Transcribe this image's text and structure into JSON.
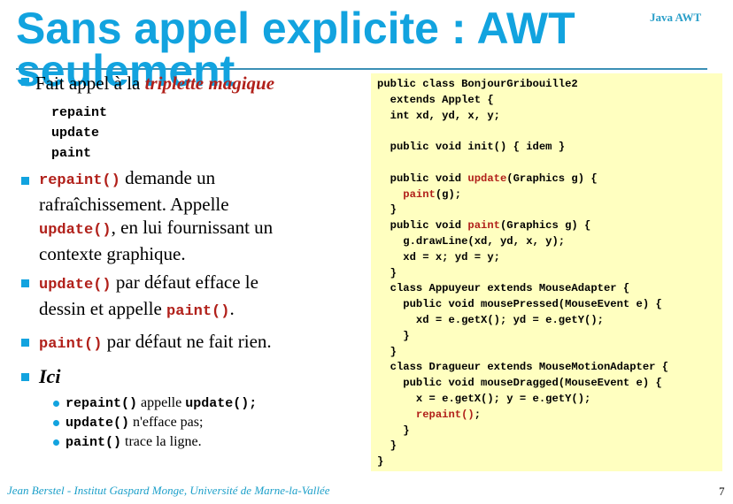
{
  "slide": {
    "title": "Sans appel explicite : AWT seulement",
    "header_tag": "Java AWT",
    "page_number": "7",
    "footer": "Jean Berstel  -   Institut Gaspard Monge, Université de Marne-la-Vallée"
  },
  "bullets": {
    "b1": {
      "prefix": "Fait appel à la ",
      "emphasis": "triplette magique",
      "methods": [
        "repaint",
        "update",
        "paint"
      ]
    },
    "b2": {
      "code1": "repaint()",
      "text1": " demande un",
      "text2": "rafraîchissement. Appelle",
      "code2": "update()",
      "text3": ", en lui fournissant un",
      "text4": "contexte graphique."
    },
    "b3": {
      "code1": "update()",
      "text1": " par défaut efface le",
      "text2": "dessin et appelle ",
      "code2": "paint()",
      "text3": "."
    },
    "b4": {
      "code1": "paint()",
      "text1": " par défaut ne fait rien."
    },
    "b5": {
      "label": "Ici",
      "items": [
        {
          "code1": "repaint()",
          "text": " appelle ",
          "code2": "update();"
        },
        {
          "code1": "update()",
          "text": " n'efface pas;"
        },
        {
          "code1": "paint()",
          "text": " trace la ligne."
        }
      ]
    }
  },
  "code": {
    "lines": [
      {
        "t": "public class BonjourGribouille2"
      },
      {
        "t": "  extends Applet {"
      },
      {
        "t": "  int xd, yd, x, y;"
      },
      {
        "t": ""
      },
      {
        "t": "  public void init() { idem }"
      },
      {
        "t": ""
      },
      {
        "pre": "  public void ",
        "red": "update",
        "post": "(Graphics g) {"
      },
      {
        "pre": "    ",
        "red": "paint",
        "post": "(g);"
      },
      {
        "t": "  }"
      },
      {
        "pre": "  public void ",
        "red": "paint",
        "post": "(Graphics g) {"
      },
      {
        "t": "    g.drawLine(xd, yd, x, y);"
      },
      {
        "t": "    xd = x; yd = y;"
      },
      {
        "t": "  }"
      },
      {
        "t": "  class Appuyeur extends MouseAdapter {"
      },
      {
        "t": "    public void mousePressed(MouseEvent e) {"
      },
      {
        "t": "      xd = e.getX(); yd = e.getY();"
      },
      {
        "t": "    }"
      },
      {
        "t": "  }"
      },
      {
        "t": "  class Dragueur extends MouseMotionAdapter {"
      },
      {
        "t": "    public void mouseDragged(MouseEvent e) {"
      },
      {
        "t": "      x = e.getX(); y = e.getY();"
      },
      {
        "pre": "      ",
        "red": "repaint()",
        "post": ";"
      },
      {
        "t": "    }"
      },
      {
        "t": "  }"
      },
      {
        "t": "}"
      }
    ]
  }
}
